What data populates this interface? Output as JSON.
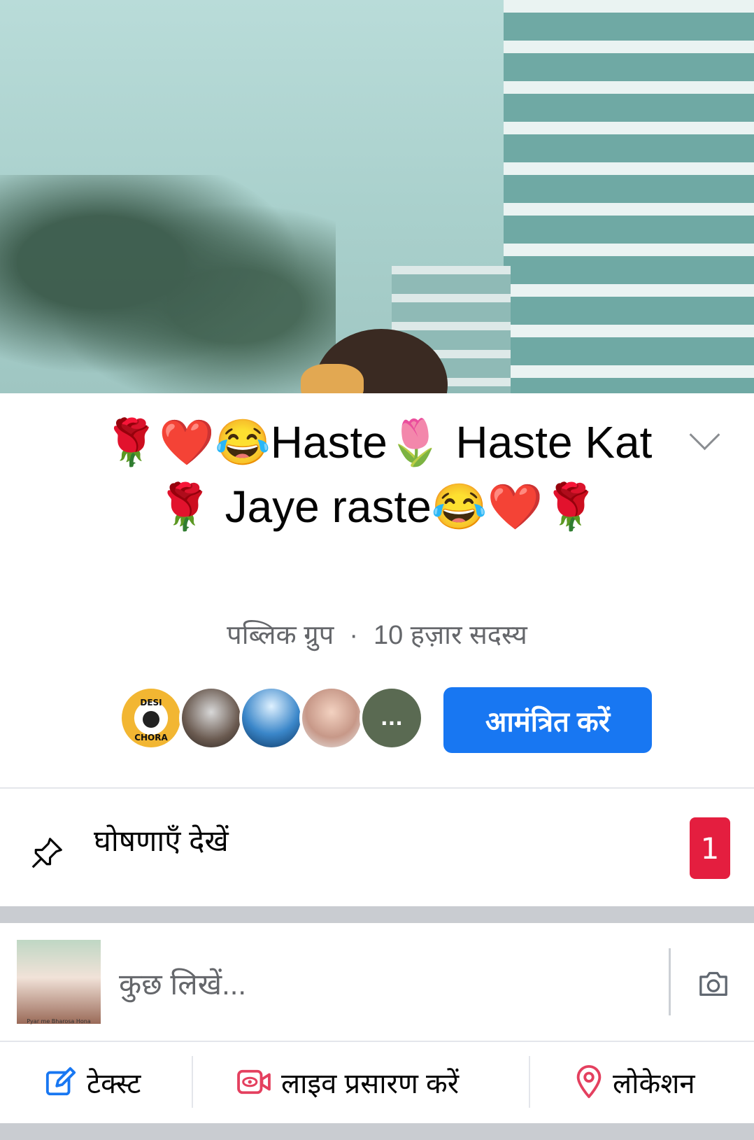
{
  "group": {
    "title": "🌹❤️😂Haste🌷 Haste Kat🌹 Jaye raste😂❤️🌹",
    "privacy": "पब्लिक ग्रुप",
    "members": "10 हज़ार सदस्य"
  },
  "members_preview": {
    "more_label": "...",
    "avatar1_text": [
      "DESI",
      "CHORA"
    ]
  },
  "invite_button": "आमंत्रित करें",
  "announcements": {
    "label": "घोषणाएँ देखें",
    "count": "1"
  },
  "composer": {
    "placeholder": "कुछ लिखें...",
    "avatar_caption": "Pyar me Bharosa Hona"
  },
  "actions": [
    {
      "label": "टेक्स्ट",
      "icon": "edit-icon"
    },
    {
      "label": "लाइव प्रसारण करें",
      "icon": "live-video-icon"
    },
    {
      "label": "लोकेशन",
      "icon": "location-pin-icon"
    }
  ],
  "colors": {
    "primary": "#1877f2",
    "badge": "#e41e3f",
    "secondary_text": "#65676b",
    "live_icon": "#e4405f",
    "text_icon": "#1877f2",
    "location_icon": "#e4405f"
  }
}
